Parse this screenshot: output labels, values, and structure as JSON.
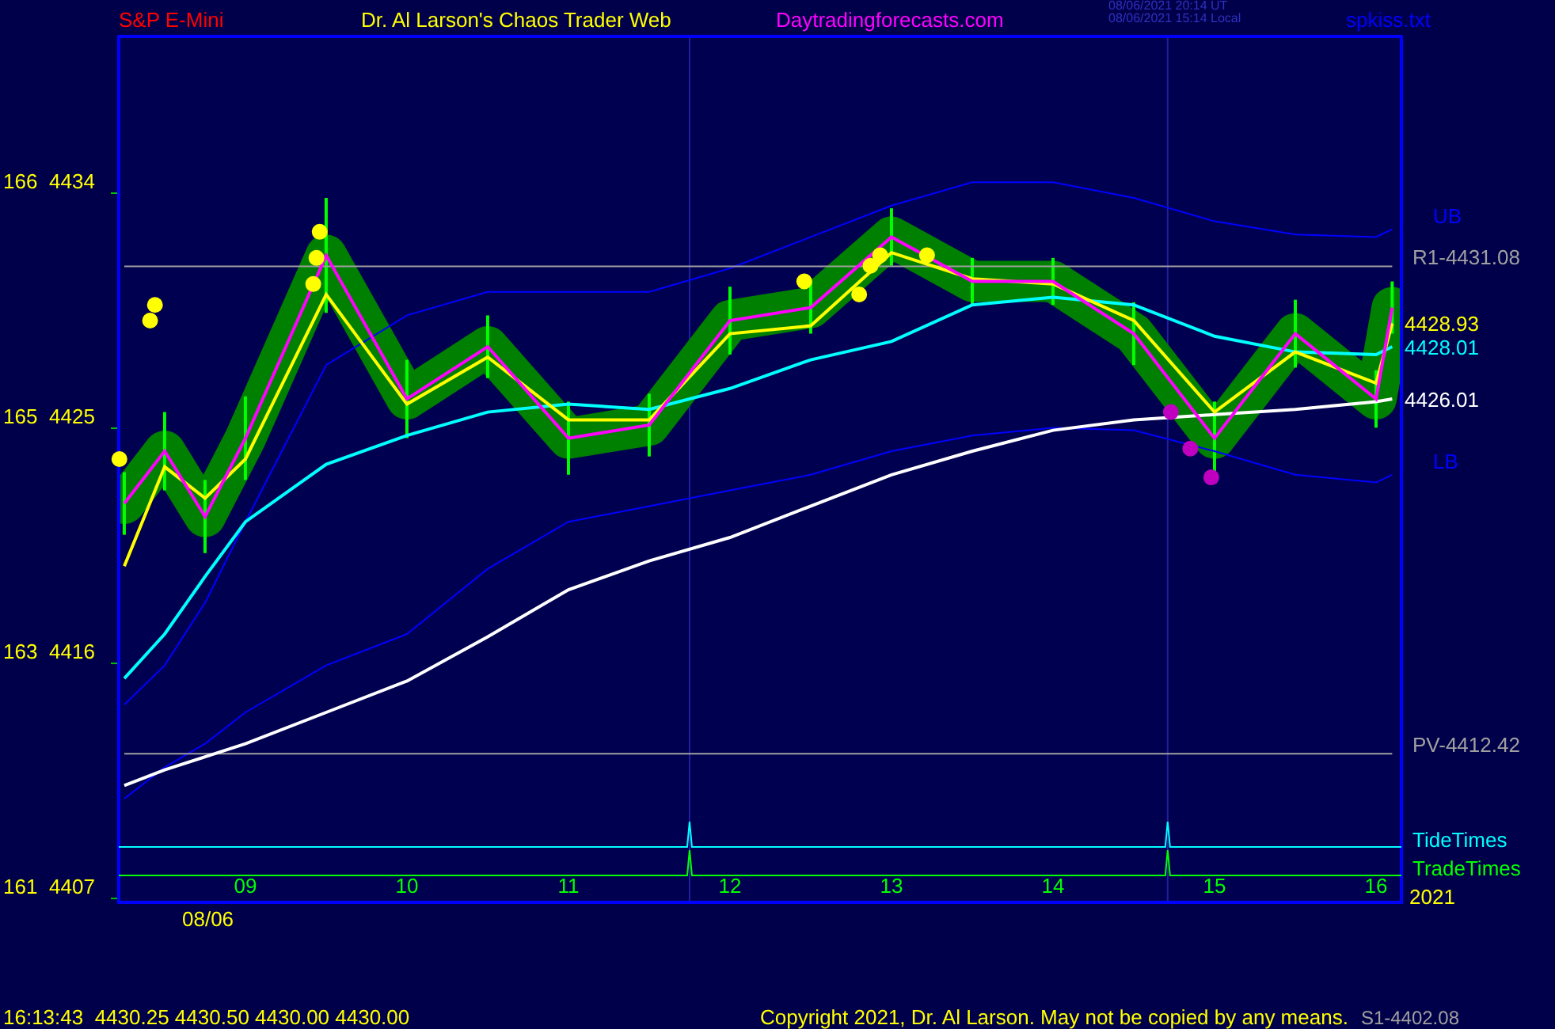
{
  "header": {
    "symbol": "S&P E-Mini",
    "title": "Dr. Al Larson's Chaos Trader Web",
    "site": "Daytradingforecasts.com",
    "time_ut": "08/06/2021 20:14 UT",
    "time_local": "08/06/2021 15:14 Local",
    "file": "spkiss.txt"
  },
  "chart": {
    "date_label": "08/06",
    "year_label": "2021",
    "alt_ticks": [
      "166",
      "165",
      "163",
      "161"
    ],
    "time_lines": [
      {
        "label": "TideTimes",
        "color": "#00ffff"
      },
      {
        "label": "TradeTimes",
        "color": "#00ff00"
      }
    ],
    "chart_data": {
      "type": "line",
      "x": [
        8.25,
        8.5,
        8.75,
        9,
        9.5,
        10,
        10.5,
        11,
        11.5,
        12,
        12.5,
        13,
        13.5,
        14,
        14.5,
        15,
        15.5,
        16,
        16.1
      ],
      "xlim": [
        8.216,
        16.157
      ],
      "ylim": [
        4406.73,
        4439.94
      ],
      "xticks": [
        {
          "value": 9,
          "label": "09"
        },
        {
          "value": 10,
          "label": "10"
        },
        {
          "value": 11,
          "label": "11"
        },
        {
          "value": 12,
          "label": "12"
        },
        {
          "value": 13,
          "label": "13"
        },
        {
          "value": 14,
          "label": "14"
        },
        {
          "value": 15,
          "label": "15"
        },
        {
          "value": 16,
          "label": "16"
        }
      ],
      "yticks": [
        4434,
        4425,
        4416,
        4407
      ],
      "ref_lines": [
        {
          "axis": "x",
          "value": 11.75
        },
        {
          "axis": "x",
          "value": 14.71
        }
      ],
      "series": [
        {
          "name": "UB",
          "color": "#0000ff",
          "values": [
            4414.3,
            4415.8,
            4418.2,
            4421.3,
            4427.3,
            4429.2,
            4430.1,
            4430.1,
            4430.1,
            4431.0,
            4432.2,
            4433.4,
            4434.3,
            4434.3,
            4433.7,
            4432.8,
            4432.3,
            4432.2,
            4432.5
          ]
        },
        {
          "name": "LB",
          "color": "#0000ff",
          "values": [
            4410.7,
            4411.9,
            4412.8,
            4414.0,
            4415.8,
            4417.0,
            4419.5,
            4421.3,
            4421.9,
            4422.5,
            4423.1,
            4424.0,
            4424.6,
            4424.9,
            4424.8,
            4424.0,
            4423.1,
            4422.8,
            4423.1
          ]
        },
        {
          "name": "R1-4431.08",
          "color": "#a0a0a0",
          "values": [
            4431.08,
            4431.08,
            4431.08,
            4431.08,
            4431.08,
            4431.08,
            4431.08,
            4431.08,
            4431.08,
            4431.08,
            4431.08,
            4431.08,
            4431.08,
            4431.08,
            4431.08,
            4431.08,
            4431.08,
            4431.08,
            4431.08
          ]
        },
        {
          "name": "PV-4412.42",
          "color": "#a0a0a0",
          "values": [
            4412.42,
            4412.42,
            4412.42,
            4412.42,
            4412.42,
            4412.42,
            4412.42,
            4412.42,
            4412.42,
            4412.42,
            4412.42,
            4412.42,
            4412.42,
            4412.42,
            4412.42,
            4412.42,
            4412.42,
            4412.42,
            4412.42
          ]
        },
        {
          "name": "4426.01",
          "color": "#ffffff",
          "values": [
            4411.2,
            4411.8,
            4412.3,
            4412.8,
            4414.0,
            4415.2,
            4416.9,
            4418.7,
            4419.8,
            4420.7,
            4421.9,
            4423.1,
            4424.0,
            4424.8,
            4425.2,
            4425.4,
            4425.6,
            4425.9,
            4426.0
          ]
        },
        {
          "name": "4428.01",
          "color": "#00ffff",
          "values": [
            4415.3,
            4417.0,
            4419.2,
            4421.3,
            4423.5,
            4424.6,
            4425.5,
            4425.8,
            4425.6,
            4426.4,
            4427.5,
            4428.2,
            4429.6,
            4429.9,
            4429.6,
            4428.4,
            4427.8,
            4427.7,
            4428.0
          ]
        },
        {
          "name": "4428.93",
          "color": "#ffff00",
          "values": [
            4419.6,
            4423.4,
            4422.2,
            4423.7,
            4430.0,
            4425.8,
            4427.6,
            4425.2,
            4425.2,
            4428.5,
            4428.8,
            4431.6,
            4430.6,
            4430.4,
            4429.0,
            4425.5,
            4427.8,
            4426.6,
            4428.9
          ]
        },
        {
          "color": "#ff00ff",
          "errors": [
            1.2,
            1.5,
            1.4,
            1.6,
            2.2,
            1.5,
            1.2,
            1.4,
            1.2,
            1.3,
            1.0,
            1.1,
            0.9,
            0.9,
            1.2,
            1.4,
            1.3,
            1.1,
            1.0
          ],
          "values": [
            4422.0,
            4424.0,
            4421.5,
            4424.5,
            4431.5,
            4426.0,
            4428.0,
            4424.5,
            4425.0,
            4429.0,
            4429.5,
            4432.2,
            4430.5,
            4430.5,
            4428.5,
            4424.5,
            4428.5,
            4426.0,
            4429.5
          ]
        },
        {
          "type": "scatter",
          "color": "#ffff00",
          "x": [
            8.22,
            8.41,
            8.44,
            9.42,
            9.44,
            9.46,
            12.46,
            12.8,
            12.87,
            12.93,
            13.22
          ],
          "values": [
            4423.7,
            4429.0,
            4429.6,
            4430.4,
            4431.4,
            4432.4,
            4430.5,
            4430.0,
            4431.1,
            4431.5,
            4431.5
          ]
        },
        {
          "type": "scatter",
          "color": "#c000c0",
          "x": [
            14.73,
            14.85,
            14.98
          ],
          "values": [
            4425.5,
            4424.1,
            4423.0
          ]
        }
      ]
    }
  },
  "footer": {
    "quote": "16:13:43  4430.25 4430.50 4430.00 4430.00",
    "copyright": "Copyright 2021, Dr. Al Larson. May not be copied by any means.",
    "support": "S1-4402.08"
  }
}
